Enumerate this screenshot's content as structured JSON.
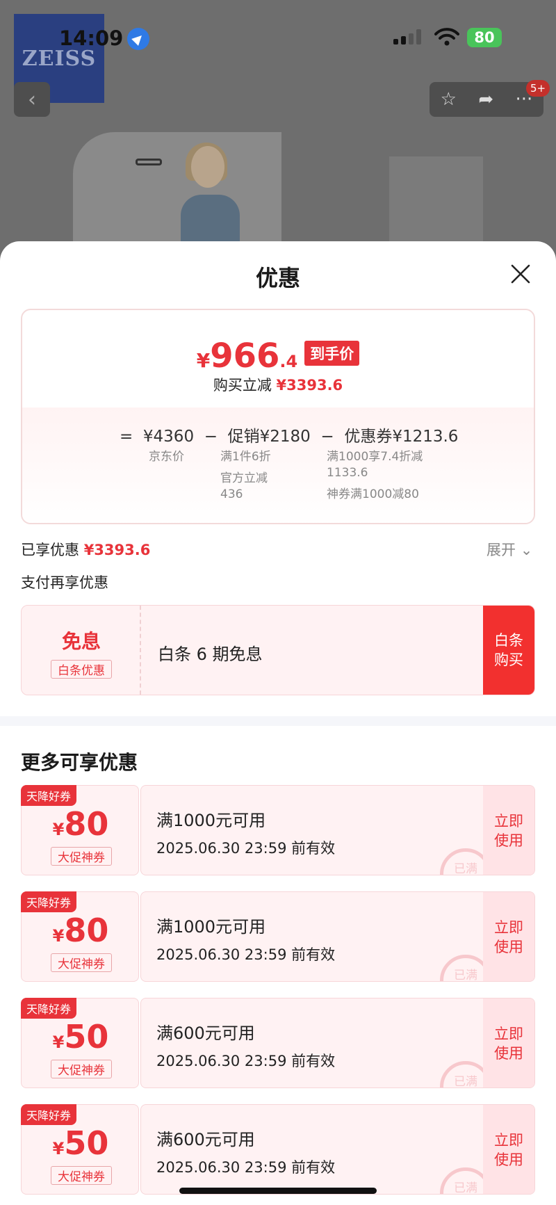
{
  "status_bar": {
    "time": "14:09",
    "battery": "80"
  },
  "brand_logo": "ZEISS",
  "header": {
    "notification_badge": "5+"
  },
  "sheet": {
    "title": "优惠",
    "price": {
      "currency": "¥",
      "integer": "966",
      "decimal": ".4",
      "tag": "到手价",
      "reduction_label": "购买立减",
      "reduction_value": "¥3393.6"
    },
    "breakdown": {
      "equals": "=",
      "minus": "−",
      "items": [
        {
          "value": "¥4360",
          "notes": [
            "京东价"
          ]
        },
        {
          "value": "促销¥2180",
          "notes": [
            "满1件6折",
            "官方立减",
            "436"
          ]
        },
        {
          "value": "优惠券¥1213.6",
          "notes": [
            "满1000享7.4折减",
            "1133.6",
            "神券满1000减80"
          ]
        }
      ]
    },
    "enjoyed": {
      "label": "已享优惠",
      "value": "¥3393.6",
      "expand": "展开"
    },
    "pay_title": "支付再享优惠",
    "baitiao": {
      "big": "免息",
      "tag": "白条优惠",
      "desc": "白条 6 期免息",
      "buy_line1": "白条",
      "buy_line2": "购买"
    },
    "more_title": "更多可享优惠",
    "coupons": [
      {
        "corner": "天降好券",
        "currency": "¥",
        "amount": "80",
        "tag": "大促神券",
        "condition": "满1000元可用",
        "validity": "2025.06.30 23:59 前有效",
        "use1": "立即",
        "use2": "使用",
        "stamp": "已满"
      },
      {
        "corner": "天降好券",
        "currency": "¥",
        "amount": "80",
        "tag": "大促神券",
        "condition": "满1000元可用",
        "validity": "2025.06.30 23:59 前有效",
        "use1": "立即",
        "use2": "使用",
        "stamp": "已满"
      },
      {
        "corner": "天降好券",
        "currency": "¥",
        "amount": "50",
        "tag": "大促神券",
        "condition": "满600元可用",
        "validity": "2025.06.30 23:59 前有效",
        "use1": "立即",
        "use2": "使用",
        "stamp": "已满"
      },
      {
        "corner": "天降好券",
        "currency": "¥",
        "amount": "50",
        "tag": "大促神券",
        "condition": "满600元可用",
        "validity": "2025.06.30 23:59 前有效",
        "use1": "立即",
        "use2": "使用",
        "stamp": "已满"
      }
    ]
  },
  "colors": {
    "accent": "#e8333a",
    "button_red": "#f2302f",
    "coupon_bg": "#fff2f3"
  }
}
